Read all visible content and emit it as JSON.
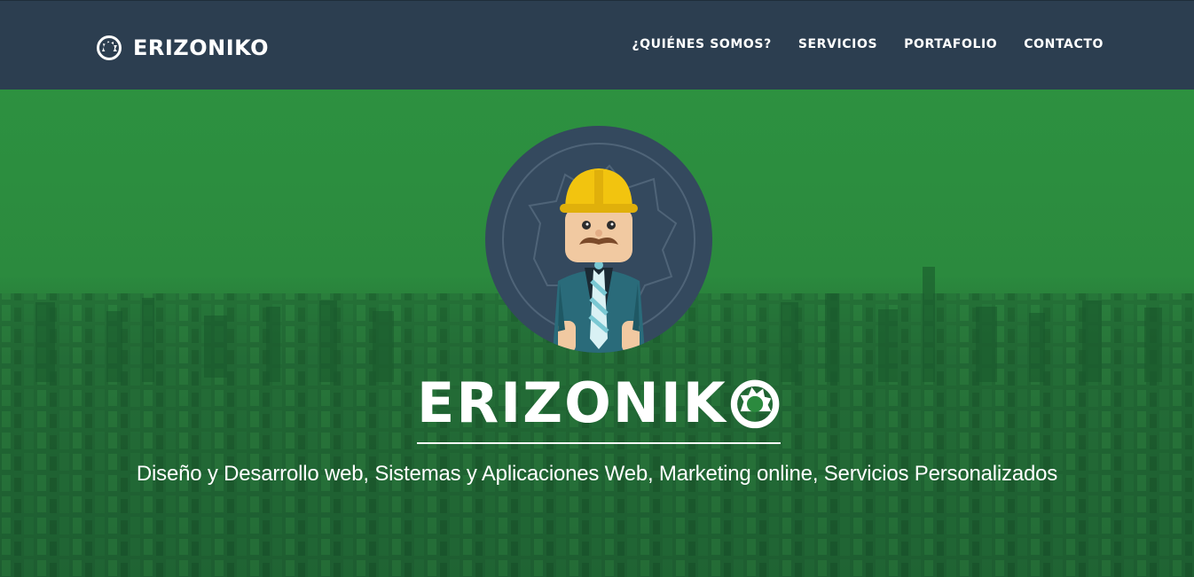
{
  "header": {
    "brand": "ERIZONIKO",
    "brand_icon": "hedgehog-circle-logo-icon",
    "nav": [
      {
        "label": "¿QUIÉNES SOMOS?"
      },
      {
        "label": "SERVICIOS"
      },
      {
        "label": "PORTAFOLIO"
      },
      {
        "label": "CONTACTO"
      }
    ]
  },
  "hero": {
    "title": "ERIZONIK",
    "title_icon": "hedgehog-o-icon",
    "subtitle": "Diseño y Desarrollo web, Sistemas y Aplicaciones Web, Marketing online, Servicios Personalizados",
    "avatar_icon": "construction-worker-avatar"
  },
  "colors": {
    "navbar": "#2c3e50",
    "hero_green": "#2b8a3e",
    "text": "#ffffff",
    "helmet": "#f2c40f",
    "avatar_bg": "#34495e"
  }
}
